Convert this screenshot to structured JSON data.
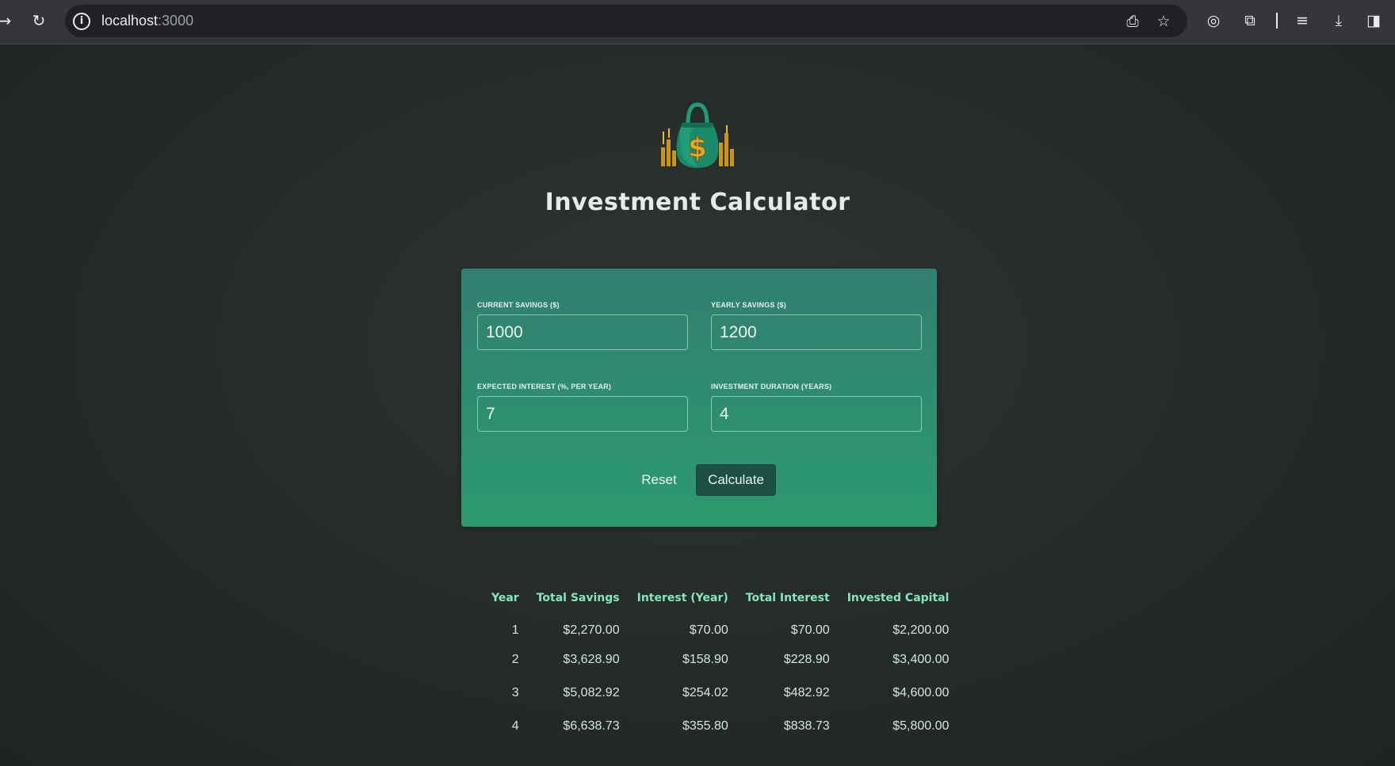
{
  "browser": {
    "url_host": "localhost",
    "url_port": ":3000"
  },
  "header": {
    "logo_icon": "money-bag-icon",
    "title": "Investment Calculator"
  },
  "form": {
    "current_savings": {
      "label": "CURRENT SAVINGS ($)",
      "value": "1000"
    },
    "yearly_savings": {
      "label": "YEARLY SAVINGS ($)",
      "value": "1200"
    },
    "expected_interest": {
      "label": "EXPECTED INTEREST (%, PER YEAR)",
      "value": "7"
    },
    "duration": {
      "label": "INVESTMENT DURATION (YEARS)",
      "value": "4"
    },
    "reset_label": "Reset",
    "calculate_label": "Calculate"
  },
  "results": {
    "headers": [
      "Year",
      "Total Savings",
      "Interest (Year)",
      "Total Interest",
      "Invested Capital"
    ],
    "rows": [
      [
        "1",
        "$2,270.00",
        "$70.00",
        "$70.00",
        "$2,200.00"
      ],
      [
        "2",
        "$3,628.90",
        "$158.90",
        "$228.90",
        "$3,400.00"
      ],
      [
        "3",
        "$5,082.92",
        "$254.02",
        "$482.92",
        "$4,600.00"
      ],
      [
        "4",
        "$6,638.73",
        "$355.80",
        "$838.73",
        "$5,800.00"
      ]
    ]
  },
  "colors": {
    "background": "#262c29",
    "card_top": "#317f70",
    "card_bottom": "#2c9a70",
    "header_text": "#83e6bf",
    "calculate_button": "#1d4f43"
  }
}
